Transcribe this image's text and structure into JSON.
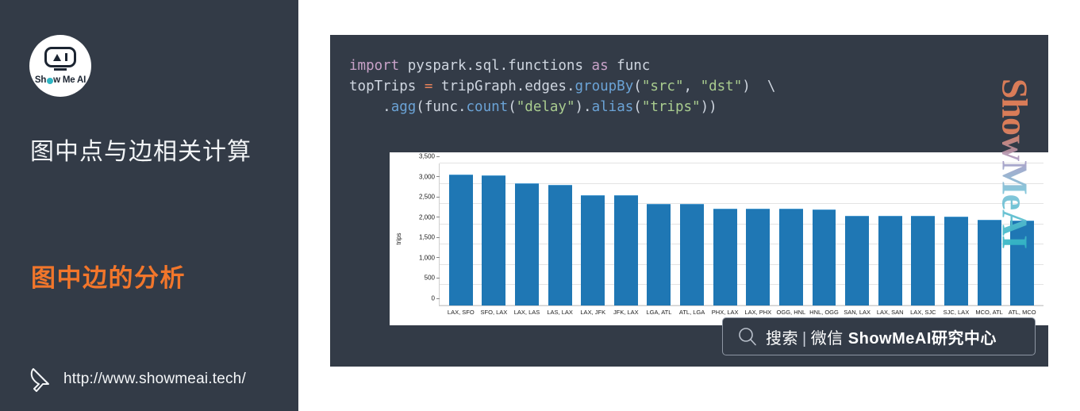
{
  "sidebar": {
    "logo": {
      "icon_name": "show-me-ai-logo",
      "brand_pre": "Sh",
      "brand_mid": "w Me AI"
    },
    "title": "图中点与边相关计算",
    "subtitle": "图中边的分析",
    "footer": {
      "cursor_icon": "cursor-arrow-icon",
      "url": "http://www.showmeai.tech/"
    },
    "colors": {
      "background": "#333b47",
      "title": "#f2f4f6",
      "accent": "#f2762b"
    }
  },
  "code": {
    "lines": [
      [
        {
          "t": "import",
          "c": "k"
        },
        {
          "t": " pyspark.sql.functions ",
          "c": "p"
        },
        {
          "t": "as",
          "c": "k"
        },
        {
          "t": " func",
          "c": "p"
        }
      ],
      [
        {
          "t": "topTrips ",
          "c": "p"
        },
        {
          "t": "=",
          "c": "op"
        },
        {
          "t": " tripGraph.edges.",
          "c": "p"
        },
        {
          "t": "groupBy",
          "c": "fn"
        },
        {
          "t": "(",
          "c": "p"
        },
        {
          "t": "\"src\"",
          "c": "s"
        },
        {
          "t": ", ",
          "c": "p"
        },
        {
          "t": "\"dst\"",
          "c": "s"
        },
        {
          "t": ")  \\",
          "c": "p"
        }
      ],
      [
        {
          "t": "    .",
          "c": "p"
        },
        {
          "t": "agg",
          "c": "fn"
        },
        {
          "t": "(func.",
          "c": "p"
        },
        {
          "t": "count",
          "c": "fn"
        },
        {
          "t": "(",
          "c": "p"
        },
        {
          "t": "\"delay\"",
          "c": "s"
        },
        {
          "t": ").",
          "c": "p"
        },
        {
          "t": "alias",
          "c": "fn"
        },
        {
          "t": "(",
          "c": "p"
        },
        {
          "t": "\"trips\"",
          "c": "s"
        },
        {
          "t": "))",
          "c": "p"
        }
      ]
    ],
    "colors": {
      "background": "#333b47",
      "keyword": "#c8a2c8",
      "operator": "#e8825a",
      "function": "#6ba3d6",
      "string": "#a9cc8f",
      "plain": "#cfd6e0"
    }
  },
  "chart_data": {
    "type": "bar",
    "title": "",
    "xlabel": "",
    "ylabel": "trips",
    "ylim": [
      0,
      3500
    ],
    "yticks": [
      0,
      500,
      1000,
      1500,
      2000,
      2500,
      3000,
      3500
    ],
    "ytick_labels": [
      "0",
      "500",
      "1,000",
      "1,500",
      "2,000",
      "2,500",
      "3,000",
      "3,500"
    ],
    "grid": true,
    "legend": "none",
    "bar_color": "#1f77b4",
    "categories": [
      "LAX, SFO",
      "SFO, LAX",
      "LAX, LAS",
      "LAS, LAX",
      "LAX, JFK",
      "JFK, LAX",
      "LGA, ATL",
      "ATL, LGA",
      "PHX, LAX",
      "LAX, PHX",
      "OGG, HNL",
      "HNL, OGG",
      "SAN, LAX",
      "LAX, SAN",
      "LAX, SJC",
      "SJC, LAX",
      "MCO, ATL",
      "ATL, MCO"
    ],
    "values": [
      3230,
      3200,
      3020,
      2970,
      2720,
      2715,
      2510,
      2505,
      2390,
      2385,
      2380,
      2375,
      2215,
      2210,
      2205,
      2200,
      2110,
      2090
    ]
  },
  "search_badge": {
    "icon_name": "magnifier-icon",
    "label_primary": "搜索",
    "separator": "|",
    "label_secondary": "微信",
    "brand": "ShowMeAI",
    "label_tail": "研究中心"
  },
  "watermark": {
    "text": "ShowMeAI"
  }
}
